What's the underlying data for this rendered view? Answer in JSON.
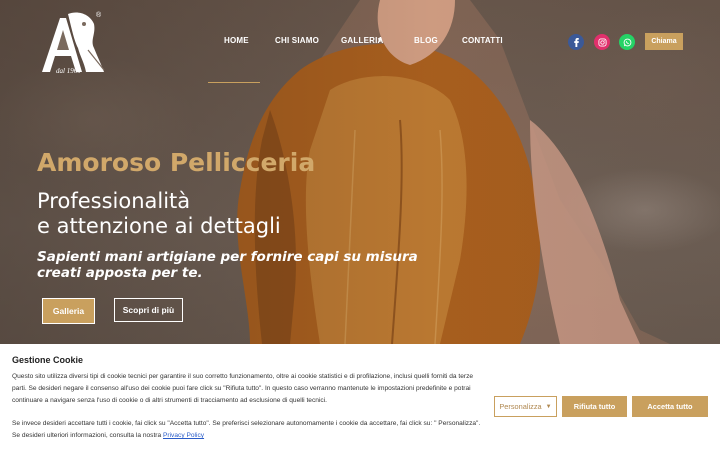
{
  "brand": {
    "registered_mark": "®",
    "established": "dal 1960"
  },
  "nav": {
    "items": [
      {
        "label": "HOME"
      },
      {
        "label": "CHI SIAMO"
      },
      {
        "label": "GALLERIA"
      },
      {
        "label": "BLOG"
      },
      {
        "label": "CONTATTI"
      }
    ],
    "dropdown_icon": "▾"
  },
  "social": [
    {
      "name": "facebook-icon",
      "color": "#3b5998"
    },
    {
      "name": "instagram-icon",
      "color": "#e1306c"
    },
    {
      "name": "whatsapp-icon",
      "color": "#25d366"
    }
  ],
  "header": {
    "call_label": "Chiama"
  },
  "hero": {
    "brand_title": "Amoroso Pellicceria",
    "headline_line1": "Professionalità",
    "headline_line2": "e attenzione ai dettagli",
    "sub_line1": "Sapienti mani artigiane per fornire capi su misura",
    "sub_line2": "creati apposta per te.",
    "btn_galleria": "Galleria",
    "btn_scopri": "Scopri di più"
  },
  "cookie": {
    "title": "Gestione Cookie",
    "text1": "Questo sito utilizza diversi tipi di cookie tecnici per garantire il suo corretto funzionamento, oltre ai cookie statistici e di profilazione, inclusi quelli forniti da terze parti. Se desideri negare il consenso all'uso dei cookie puoi fare click su \"Rifiuta tutto\". In questo caso verranno mantenute le impostazioni predefinite e potrai continuare a navigare senza l'uso di cookie o di altri strumenti di tracciamento ad esclusione di quelli tecnici.",
    "text2": "Se invece desideri accettare tutti i cookie, fai click su \"Accetta tutto\". Se preferisci selezionare autonomamente i cookie da accettare, fai click su: \" Personalizza\". Se desideri ulteriori informazioni, consulta la nostra Privacy Policy.",
    "privacy_link": "Privacy Policy",
    "btn_personalizza": "Personalizza",
    "btn_rifiuta": "Rifiuta tutto",
    "btn_accetta": "Accetta tutto"
  },
  "colors": {
    "accent": "#c9a05e",
    "brand_title": "#d1a86a",
    "link": "#2a5cc8"
  }
}
